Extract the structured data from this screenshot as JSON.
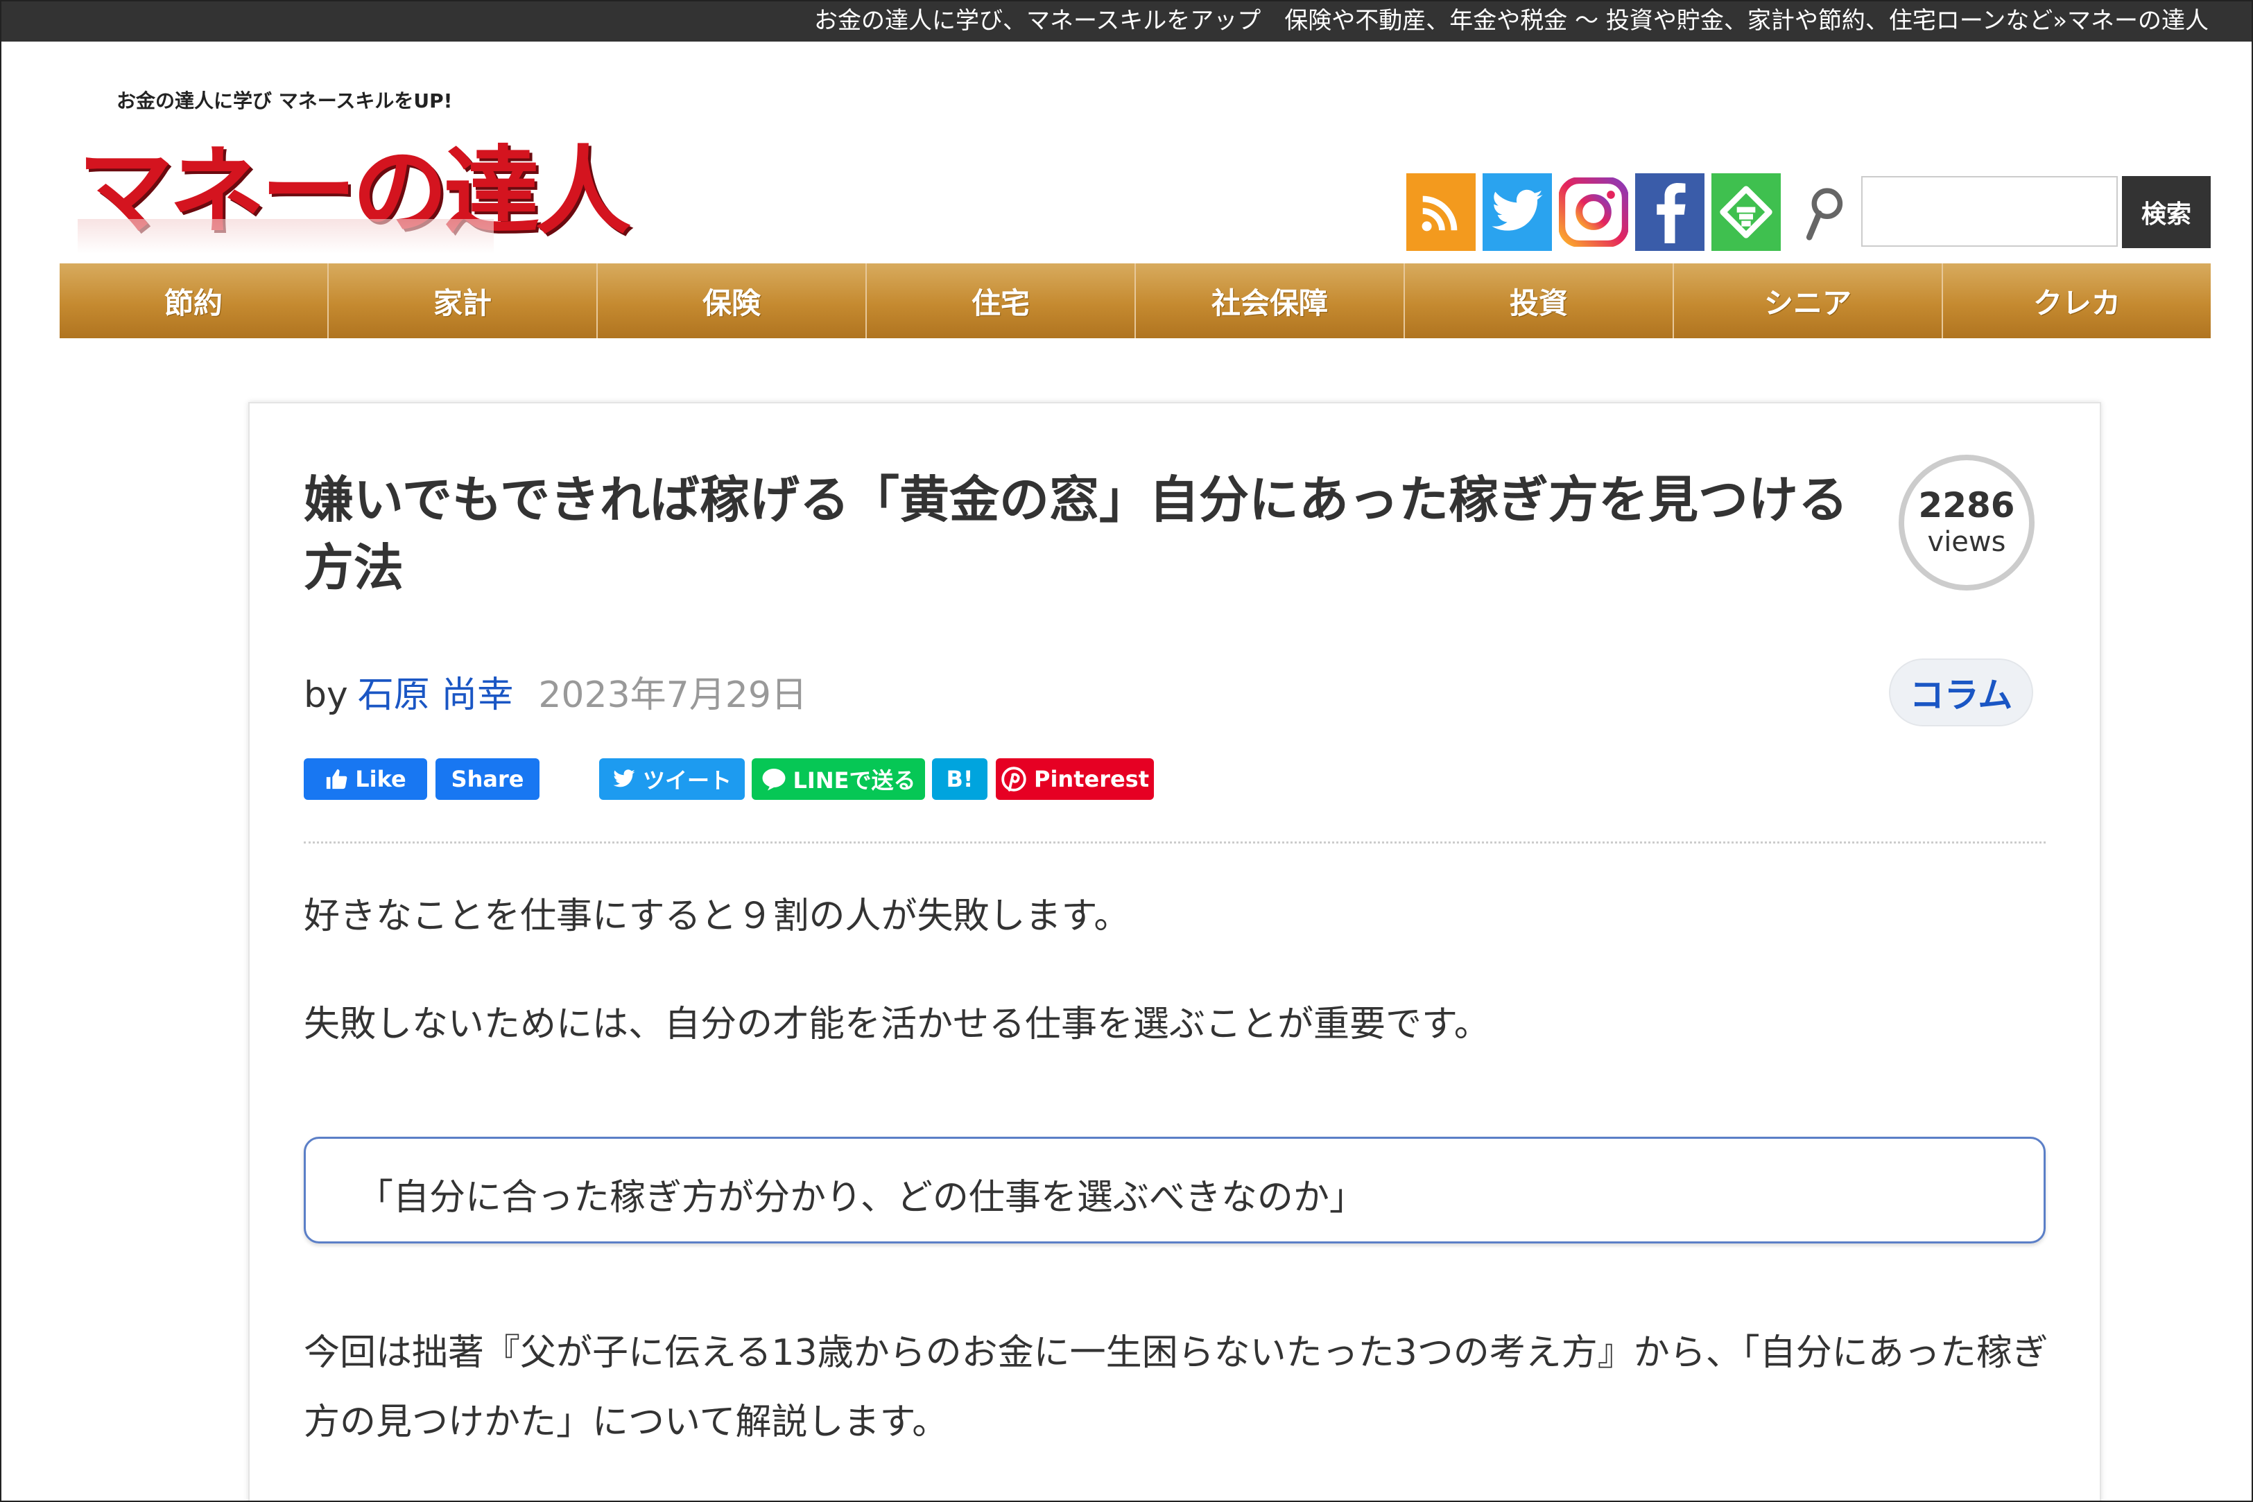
{
  "topbar": {
    "text": "お金の達人に学び、マネースキルをアップ　保険や不動産、年金や税金 〜 投資や貯金、家計や節約、住宅ローンなど»マネーの達人"
  },
  "logo": {
    "tagline": "お金の達人に学び マネースキルをUP!",
    "name": "マネーの達人"
  },
  "header": {
    "social_icons": [
      "rss-icon",
      "twitter-icon",
      "instagram-icon",
      "facebook-icon",
      "feedly-icon"
    ],
    "search": {
      "placeholder": "",
      "button_label": "検索"
    }
  },
  "nav": {
    "items": [
      "節約",
      "家計",
      "保険",
      "住宅",
      "社会保障",
      "投資",
      "シニア",
      "クレカ"
    ]
  },
  "article": {
    "title": "嫌いでもできれば稼げる「黄金の窓」自分にあった稼ぎ方を見つける方法",
    "views_count": "2286",
    "views_label": "views",
    "by_label": "by",
    "author": "石原 尚幸",
    "date": "2023年7月29日",
    "category": "コラム",
    "share": {
      "fb_like": "Like",
      "fb_share": "Share",
      "tweet": "ツイート",
      "line": "LINEで送る",
      "hatena": "B!",
      "pinterest": "Pinterest"
    },
    "paragraphs": [
      "好きなことを仕事にすると９割の人が失敗します。",
      "失敗しないためには、自分の才能を活かせる仕事を選ぶことが重要です。",
      "今回は拙著『父が子に伝える13歳からのお金に一生困らないたった3つの考え方』から、「自分にあった稼ぎ方の見つけかた」について解説します。"
    ],
    "callout": "「自分に合った稼ぎ方が分かり、どの仕事を選ぶべきなのか」"
  },
  "colors": {
    "nav_gold": "#c58a30",
    "link_blue": "#1a56c4",
    "topbar": "#333333"
  }
}
